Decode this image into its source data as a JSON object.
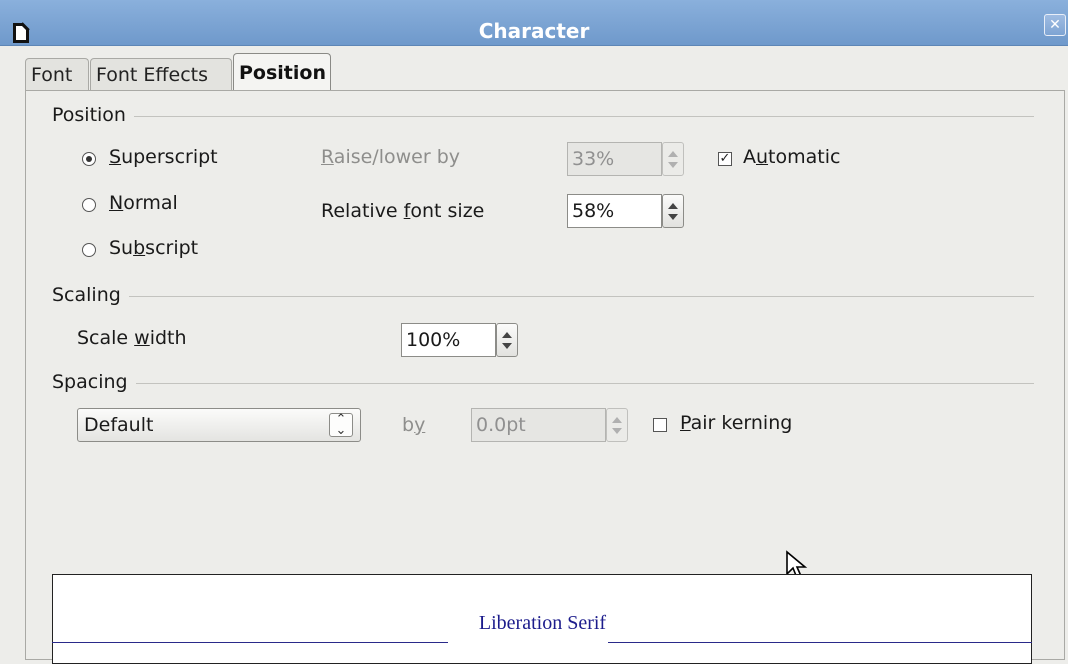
{
  "window": {
    "title": "Character",
    "app_icon": "document-icon",
    "close_icon": "close-icon"
  },
  "tabs": [
    {
      "label": "Font",
      "active": false
    },
    {
      "label": "Font Effects",
      "active": false
    },
    {
      "label": "Position",
      "active": true
    }
  ],
  "position_section": {
    "heading": "Position",
    "options": [
      {
        "pre": "",
        "key": "S",
        "post": "uperscript",
        "selected": true
      },
      {
        "pre": "",
        "key": "N",
        "post": "ormal",
        "selected": false
      },
      {
        "pre": "Su",
        "key": "b",
        "post": "script",
        "selected": false
      }
    ],
    "raise_lower": {
      "pre": "",
      "key": "R",
      "post": "aise/lower by",
      "value": "33%",
      "enabled": false
    },
    "automatic": {
      "pre": "A",
      "key": "u",
      "post": "tomatic",
      "checked": true
    },
    "relative_font_size": {
      "pre": "Relative ",
      "key": "f",
      "post": "ont size",
      "value": "58%"
    }
  },
  "scaling_section": {
    "heading": "Scaling",
    "scale_width": {
      "pre": "Scale ",
      "key": "w",
      "post": "idth",
      "value": "100%"
    }
  },
  "spacing_section": {
    "heading": "Spacing",
    "selected": "Default",
    "by": {
      "pre": "b",
      "key": "y",
      "post": "",
      "value": "0.0pt",
      "enabled": false
    },
    "pair_kerning": {
      "pre": "",
      "key": "P",
      "post": "air kerning",
      "checked": false
    }
  },
  "preview": {
    "text": "Liberation Serif"
  },
  "colors": {
    "titlebar": "#7ea4d3",
    "preview_text": "#1c1c8c",
    "background": "#ededea"
  }
}
